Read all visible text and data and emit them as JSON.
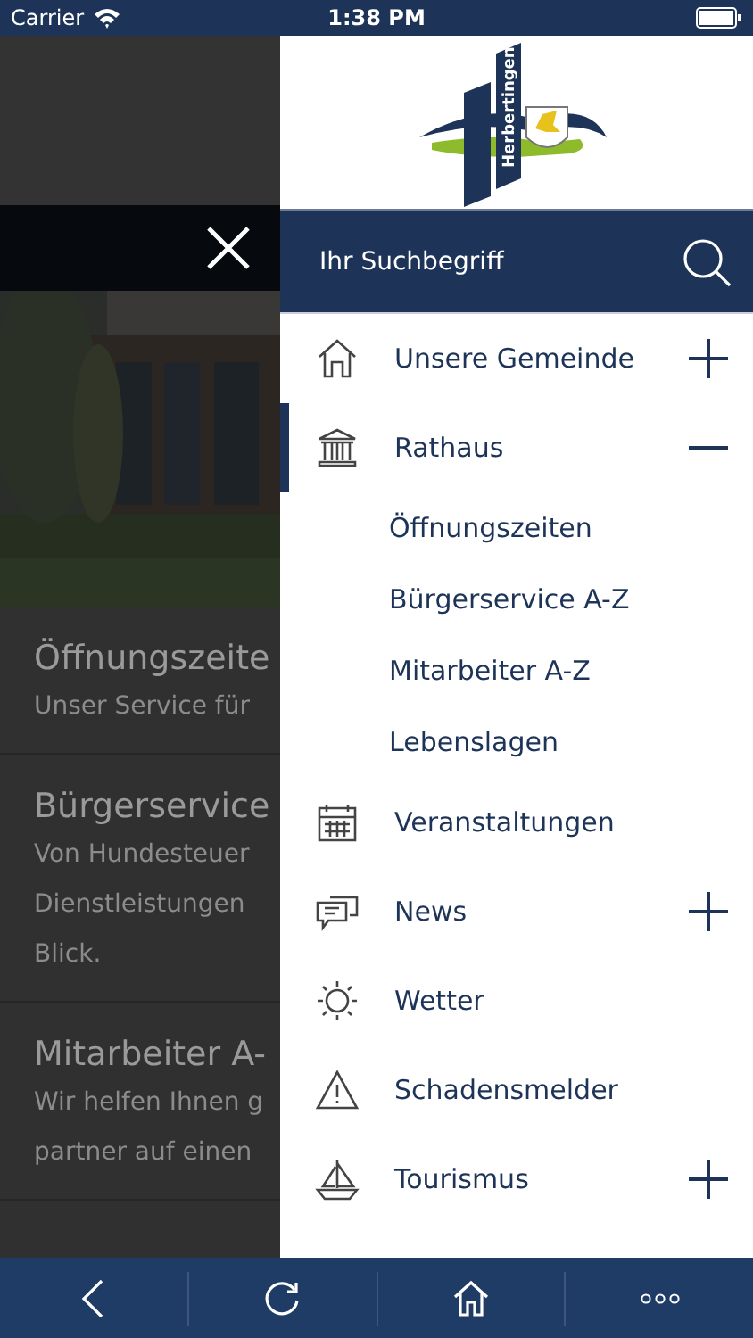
{
  "status_bar": {
    "carrier": "Carrier",
    "time": "1:38 PM"
  },
  "background_page": {
    "articles": [
      {
        "title": "Öffnungszeite",
        "lines": [
          "Unser Service für"
        ]
      },
      {
        "title": "Bürgerservice",
        "lines": [
          "Von Hundesteuer",
          "Dienstleistungen",
          "Blick."
        ]
      },
      {
        "title": "Mitarbeiter A-",
        "lines": [
          "Wir helfen Ihnen g",
          "partner auf einen"
        ]
      }
    ]
  },
  "drawer": {
    "logo_text": "Herbertingen",
    "search": {
      "placeholder": "Ihr Suchbegriff"
    },
    "items": [
      {
        "label": "Unsere Gemeinde",
        "kind": "group",
        "expanded": false,
        "selected": false
      },
      {
        "label": "Rathaus",
        "kind": "group",
        "expanded": true,
        "selected": true,
        "children": [
          {
            "label": "Öffnungszeiten"
          },
          {
            "label": "Bürgerservice A-Z"
          },
          {
            "label": "Mitarbeiter A-Z"
          },
          {
            "label": "Lebenslagen"
          }
        ]
      },
      {
        "label": "Veranstaltungen",
        "kind": "link",
        "selected": false
      },
      {
        "label": "News",
        "kind": "group",
        "expanded": false,
        "selected": false
      },
      {
        "label": "Wetter",
        "kind": "link",
        "selected": false
      },
      {
        "label": "Schadensmelder",
        "kind": "link",
        "selected": false
      },
      {
        "label": "Tourismus",
        "kind": "group",
        "expanded": false,
        "selected": false
      }
    ]
  }
}
